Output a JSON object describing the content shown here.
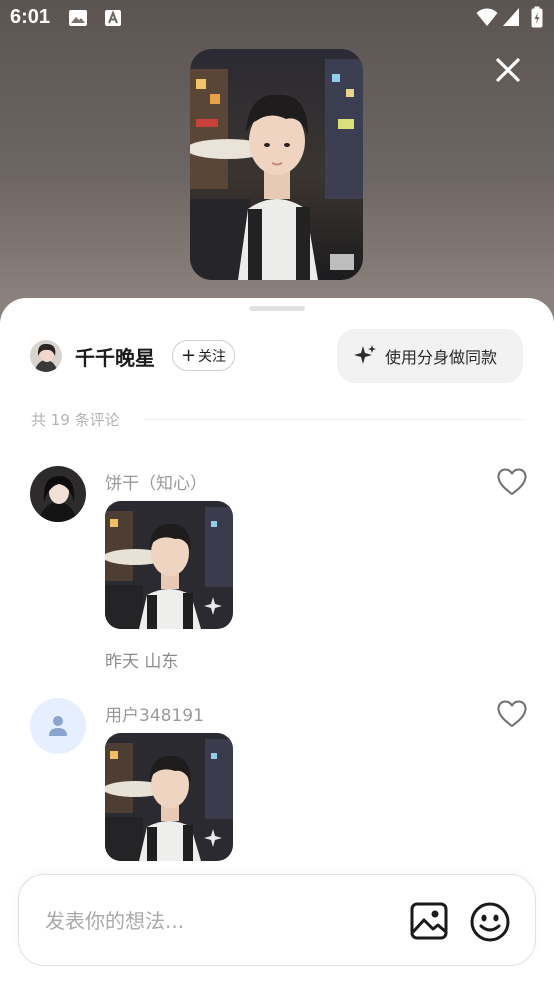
{
  "status_bar": {
    "time": "6:01"
  },
  "post": {
    "author_name": "千千晚星",
    "follow_label": "关注",
    "follow_plus": "+",
    "use_same_label": "使用分身做同款"
  },
  "comments": {
    "count_label": "共 19 条评论",
    "items": [
      {
        "name": "饼干（知心）",
        "meta": "昨天  山东"
      },
      {
        "name": "用户348191"
      }
    ]
  },
  "composer": {
    "placeholder": "发表你的想法..."
  },
  "icons": {
    "close": "close-icon",
    "sparkle": "sparkle-icon",
    "heart": "heart-outline-icon",
    "image": "image-icon",
    "emoji": "smiley-icon",
    "default_avatar": "person-icon"
  },
  "colors": {
    "sheet_bg": "#ffffff",
    "muted_text": "#9a9a9a",
    "default_avatar_bg": "#e6efff",
    "default_avatar_fg": "#8aa4cf"
  }
}
